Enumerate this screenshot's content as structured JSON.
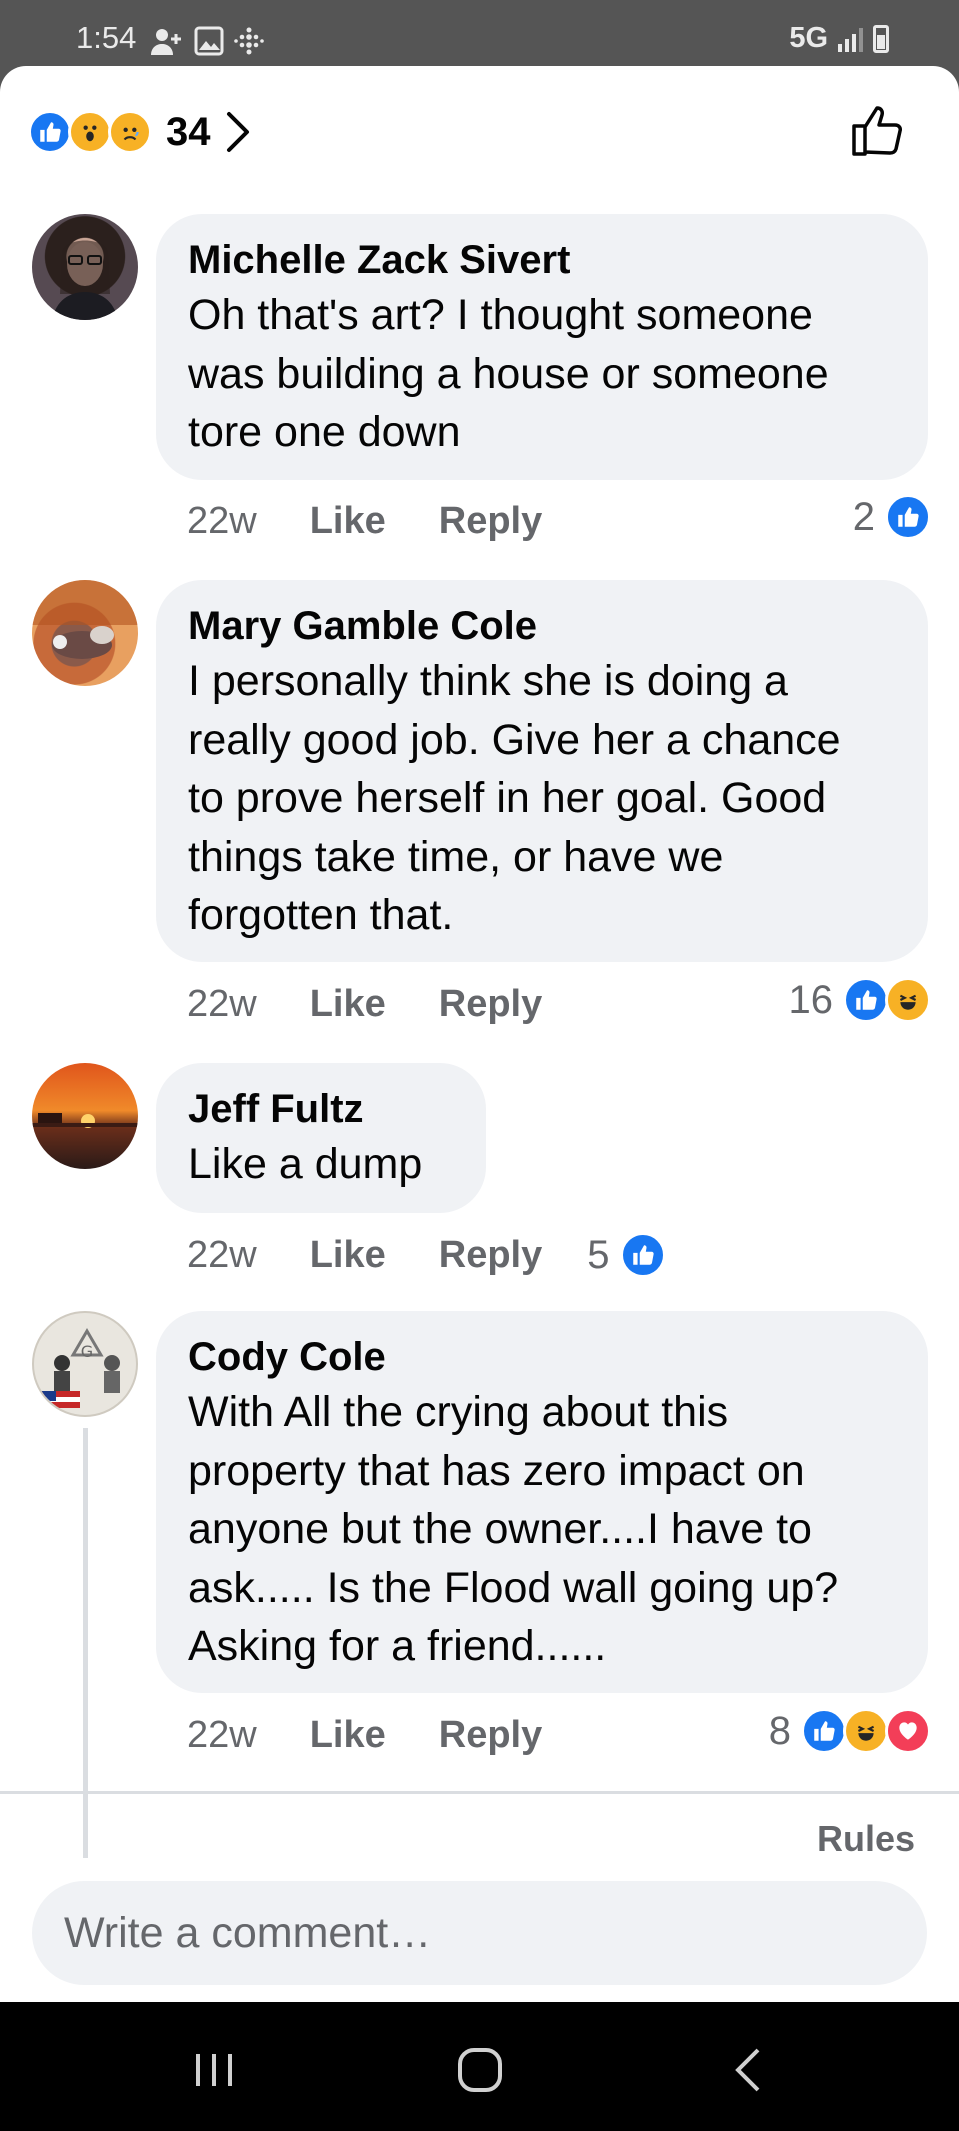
{
  "status_bar": {
    "time": "1:54",
    "network": "5G"
  },
  "post_reactions": {
    "count": "34",
    "types": [
      "like",
      "wow",
      "sad"
    ]
  },
  "comments": [
    {
      "author": "Michelle Zack Sivert",
      "lines": [
        "Oh that's art? I thought someone",
        "was building a house or someone",
        "tore one down"
      ],
      "age": "22w",
      "like_label": "Like",
      "reply_label": "Reply",
      "reaction_count": "2",
      "reactions": [
        "like"
      ]
    },
    {
      "author": "Mary Gamble Cole",
      "lines": [
        "I personally think she is doing a",
        "really good job. Give her a chance",
        "to prove herself in her goal. Good",
        "things take time, or have we",
        "forgotten that."
      ],
      "age": "22w",
      "like_label": "Like",
      "reply_label": "Reply",
      "reaction_count": "16",
      "reactions": [
        "like",
        "haha"
      ]
    },
    {
      "author": "Jeff Fultz",
      "lines": [
        "Like a dump"
      ],
      "age": "22w",
      "like_label": "Like",
      "reply_label": "Reply",
      "reaction_count": "5",
      "reactions": [
        "like"
      ]
    },
    {
      "author": "Cody Cole",
      "lines": [
        "With All the crying about this",
        "property that has zero impact on",
        "anyone but the owner....I have to",
        "ask..... Is the Flood wall going up?",
        "Asking for a friend......"
      ],
      "age": "22w",
      "like_label": "Like",
      "reply_label": "Reply",
      "reaction_count": "8",
      "reactions": [
        "like",
        "haha",
        "love"
      ]
    }
  ],
  "footer": {
    "rules_label": "Rules",
    "composer_placeholder": "Write a comment…"
  },
  "colors": {
    "accent": "#1877f2",
    "bubble": "#f0f2f5",
    "meta": "#65676b",
    "haha": "#f7b125",
    "love": "#f33e58"
  }
}
